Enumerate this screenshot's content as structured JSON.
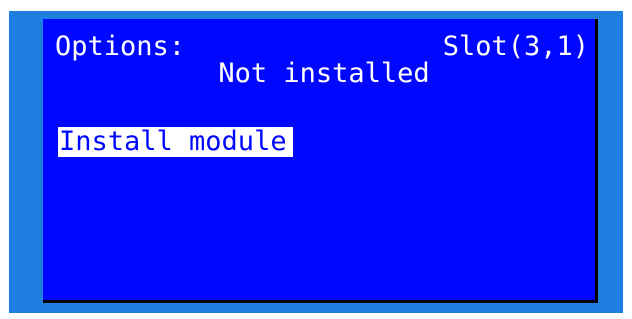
{
  "header": {
    "title": "Options:",
    "slot": "Slot(3,1)"
  },
  "status": {
    "text": "Not installed"
  },
  "menu": {
    "items": [
      {
        "label": "Install module",
        "selected": true
      }
    ]
  },
  "colors": {
    "screen_background": "#0007ff",
    "bezel": "#1f7fe0",
    "text": "#ffffff",
    "highlight_background": "#ffffff",
    "highlight_text": "#0007ff"
  }
}
